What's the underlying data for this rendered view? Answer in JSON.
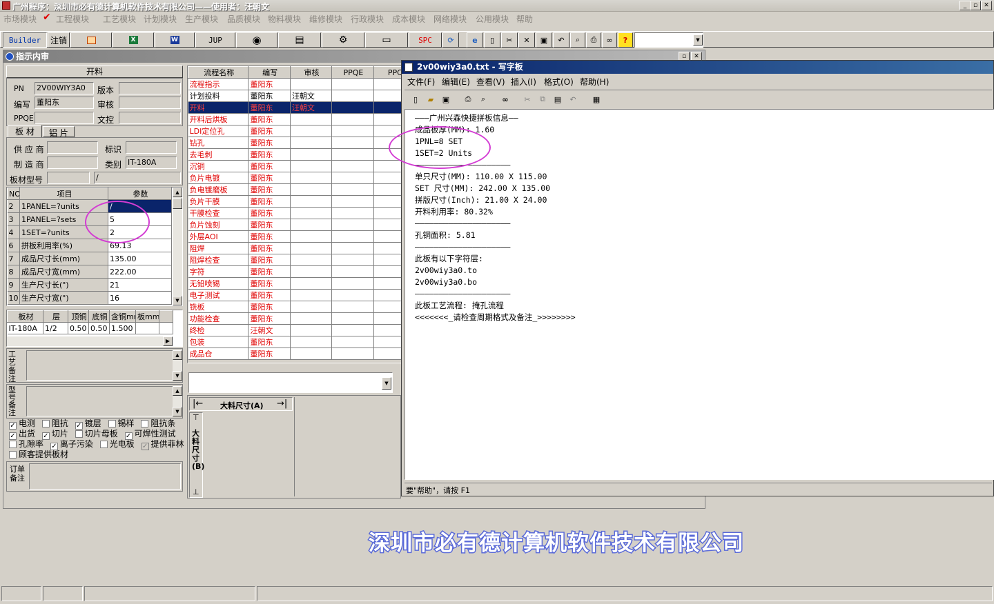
{
  "app": {
    "title": "广州程序：深圳市必有德计算机软件技术有限公司——使用者：汪朝文",
    "menu": [
      "市场模块",
      "工程模块",
      "工艺模块",
      "计划模块",
      "生产模块",
      "品质模块",
      "物料模块",
      "维修模块",
      "行政模块",
      "成本模块",
      "网络模块",
      "公用模块",
      "帮助"
    ],
    "toolbar": {
      "builder": "Builder",
      "logout": "注销",
      "jup": "JUP",
      "spc": "SPC"
    },
    "watermark": "深圳市必有德计算机软件技术有限公司"
  },
  "window": {
    "title": "指示内审",
    "section_title": "开料",
    "fields": {
      "pn_label": "PN",
      "pn_value": "2V00WIY3A0",
      "version_label": "版本",
      "author_label": "编写",
      "author_value": "董阳东",
      "review_label": "审核",
      "ppqe_label": "PPQE",
      "doccontrol_label": "文控"
    },
    "tabs": [
      "板 材",
      "铝 片"
    ],
    "material": {
      "supplier_label": "供 应 商",
      "mark_label": "标识",
      "maker_label": "制 造 商",
      "category_label": "类别",
      "category_value": "IT-180A",
      "model_label": "板材型号",
      "model_value": "/"
    },
    "params": {
      "headers": [
        "NO",
        "项目",
        "参数"
      ],
      "rows": [
        {
          "no": "2",
          "item": "1PANEL=?units",
          "value": "/"
        },
        {
          "no": "3",
          "item": "1PANEL=?sets",
          "value": "5"
        },
        {
          "no": "4",
          "item": "1SET=?units",
          "value": "2"
        },
        {
          "no": "6",
          "item": "拼板利用率(%)",
          "value": "69.13"
        },
        {
          "no": "7",
          "item": "成品尺寸长(mm)",
          "value": "135.00"
        },
        {
          "no": "8",
          "item": "成品尺寸宽(mm)",
          "value": "222.00"
        },
        {
          "no": "9",
          "item": "生产尺寸长(\")",
          "value": "21"
        },
        {
          "no": "10",
          "item": "生产尺寸宽(\")",
          "value": "16"
        }
      ]
    },
    "board": {
      "headers": [
        "板材",
        "层",
        "顶铜",
        "底铜",
        "含铜mm",
        "板mm"
      ],
      "row": [
        "IT-180A",
        "1/2",
        "0.50",
        "0.50",
        "1.500",
        ""
      ]
    },
    "notes": {
      "process_note": "工艺备注",
      "model_note": "型号备注",
      "order_note": "订单备注"
    },
    "checkboxes": [
      {
        "label": "电测",
        "checked": true
      },
      {
        "label": "阻抗",
        "checked": false
      },
      {
        "label": "镀层",
        "checked": true
      },
      {
        "label": "锡样",
        "checked": false
      },
      {
        "label": "阻抗条",
        "checked": false
      },
      {
        "label": "出货",
        "checked": true
      },
      {
        "label": "切片",
        "checked": true
      },
      {
        "label": "切片母板",
        "checked": false
      },
      {
        "label": "可焊性测试",
        "checked": true
      },
      {
        "label": "孔隙率",
        "checked": false
      },
      {
        "label": "离子污染",
        "checked": true
      },
      {
        "label": "光电板",
        "checked": false
      },
      {
        "label": "提供菲林",
        "checked": true
      },
      {
        "label": "顾客提供板材",
        "checked": false
      }
    ],
    "flow": {
      "headers": [
        "流程名称",
        "编写",
        "审核",
        "PPQE",
        "PPC"
      ],
      "rows": [
        {
          "name": "流程指示",
          "author": "董阳东",
          "reviewer": "",
          "red": true
        },
        {
          "name": "计划投料",
          "author": "董阳东",
          "reviewer": "汪朝文",
          "red": false
        },
        {
          "name": "开料",
          "author": "董阳东",
          "reviewer": "汪朝文",
          "red": true,
          "selected": true
        },
        {
          "name": "开料后烘板",
          "author": "董阳东",
          "reviewer": "",
          "red": true
        },
        {
          "name": "LDI定位孔",
          "author": "董阳东",
          "reviewer": "",
          "red": true
        },
        {
          "name": "钻孔",
          "author": "董阳东",
          "reviewer": "",
          "red": true
        },
        {
          "name": "去毛刺",
          "author": "董阳东",
          "reviewer": "",
          "red": true
        },
        {
          "name": "沉铜",
          "author": "董阳东",
          "reviewer": "",
          "red": true
        },
        {
          "name": "负片电镀",
          "author": "董阳东",
          "reviewer": "",
          "red": true
        },
        {
          "name": "负电镀磨板",
          "author": "董阳东",
          "reviewer": "",
          "red": true
        },
        {
          "name": "负片干膜",
          "author": "董阳东",
          "reviewer": "",
          "red": true
        },
        {
          "name": "干膜检查",
          "author": "董阳东",
          "reviewer": "",
          "red": true
        },
        {
          "name": "负片蚀刻",
          "author": "董阳东",
          "reviewer": "",
          "red": true
        },
        {
          "name": "外层AOI",
          "author": "董阳东",
          "reviewer": "",
          "red": true
        },
        {
          "name": "阻焊",
          "author": "董阳东",
          "reviewer": "",
          "red": true
        },
        {
          "name": "阻焊检查",
          "author": "董阳东",
          "reviewer": "",
          "red": true
        },
        {
          "name": "字符",
          "author": "董阳东",
          "reviewer": "",
          "red": true
        },
        {
          "name": "无铅喷锡",
          "author": "董阳东",
          "reviewer": "",
          "red": true
        },
        {
          "name": "电子测试",
          "author": "董阳东",
          "reviewer": "",
          "red": true
        },
        {
          "name": "铣板",
          "author": "董阳东",
          "reviewer": "",
          "red": true
        },
        {
          "name": "功能检查",
          "author": "董阳东",
          "reviewer": "",
          "red": true
        },
        {
          "name": "终检",
          "author": "汪朝文",
          "reviewer": "",
          "red": true
        },
        {
          "name": "包装",
          "author": "董阳东",
          "reviewer": "",
          "red": true
        },
        {
          "name": "成品仓",
          "author": "董阳东",
          "reviewer": "",
          "red": true
        }
      ]
    },
    "diagram": {
      "width_label": "大料尺寸(A)",
      "height_label": "大料尺寸(B)"
    }
  },
  "notepad": {
    "title": "2v00wiy3a0.txt - 写字板",
    "menu": [
      "文件(F)",
      "编辑(E)",
      "查看(V)",
      "插入(I)",
      "格式(O)",
      "帮助(H)"
    ],
    "lines": [
      "———广州兴森快捷拼板信息——",
      "成品板厚(MM): 1.60",
      "1PNL=8 SET",
      "1SET=2 Units",
      "————————————————————",
      "单只尺寸(MM): 110.00 X 115.00",
      "SET 尺寸(MM): 242.00 X 135.00",
      "拼版尺寸(Inch): 21.00 X 24.00",
      "开料利用率: 80.32%",
      "————————————————————",
      "孔铜面积: 5.81",
      "————————————————————",
      "此板有以下字符层:",
      "2v00wiy3a0.to",
      "2v00wiy3a0.bo",
      "————————————————————",
      "此板工艺流程: 掩孔流程",
      "<<<<<<<_请检查周期格式及备注_>>>>>>>>"
    ],
    "status": "要\"帮助\"，请按 F1"
  },
  "colors": {
    "selection": "#0a246a",
    "red_text": "#e00000",
    "annotation": "#d33cd3",
    "watermark": "#5a6ad8"
  }
}
